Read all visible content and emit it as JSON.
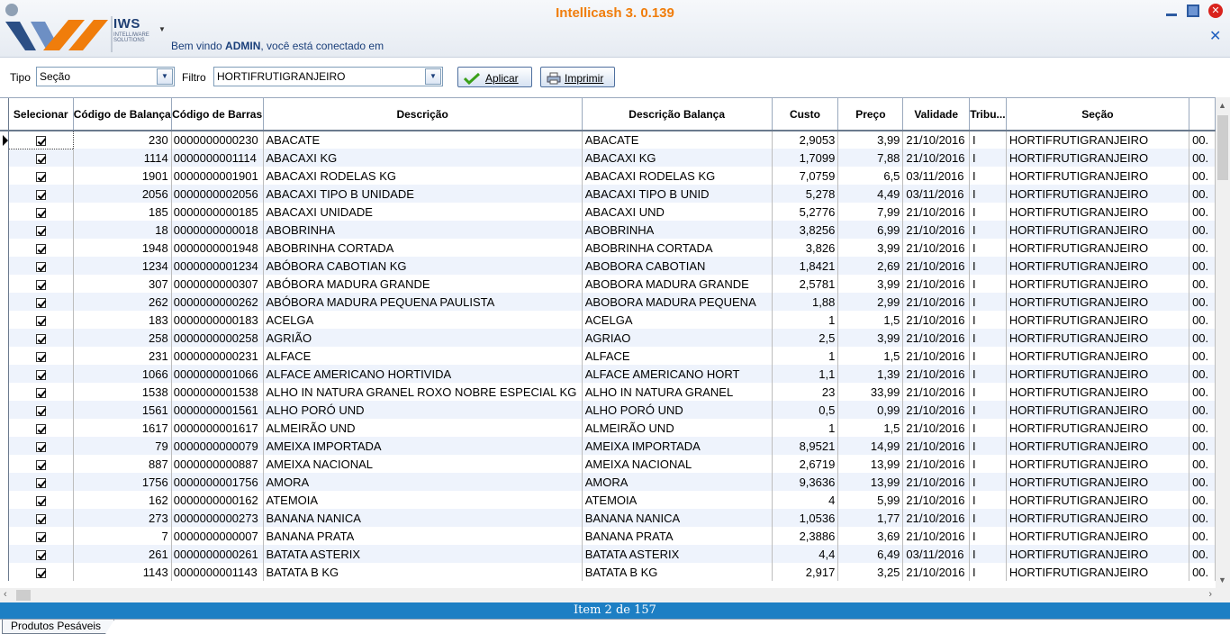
{
  "app": {
    "title": "Intellicash 3. 0.139",
    "logo_text": "IWS",
    "logo_sub": "INTELLIWARE SOLUTIONS",
    "welcome_prefix": "Bem vindo ",
    "welcome_user": "ADMIN",
    "welcome_suffix": ", você está conectado em"
  },
  "toolbar": {
    "tipo_label": "Tipo",
    "tipo_value": "Seção",
    "filtro_label": "Filtro",
    "filtro_value": "HORTIFRUTIGRANJEIRO",
    "apply_label": "Aplicar",
    "print_label": "Imprimir"
  },
  "grid": {
    "columns": [
      "Selecionar",
      "Código de Balança",
      "Código de Barras",
      "Descrição",
      "Descrição Balança",
      "Custo",
      "Preço",
      "Validade",
      "Tribu...",
      "Seção"
    ],
    "rows": [
      [
        "230",
        "0000000000230",
        "ABACATE",
        "ABACATE",
        "2,9053",
        "3,99",
        "21/10/2016",
        "I",
        "HORTIFRUTIGRANJEIRO",
        "00."
      ],
      [
        "1114",
        "0000000001114",
        "ABACAXI KG",
        "ABACAXI KG",
        "1,7099",
        "7,88",
        "21/10/2016",
        "I",
        "HORTIFRUTIGRANJEIRO",
        "00."
      ],
      [
        "1901",
        "0000000001901",
        "ABACAXI RODELAS KG",
        "ABACAXI RODELAS KG",
        "7,0759",
        "6,5",
        "03/11/2016",
        "I",
        "HORTIFRUTIGRANJEIRO",
        "00."
      ],
      [
        "2056",
        "0000000002056",
        "ABACAXI TIPO B UNIDADE",
        "ABACAXI TIPO B UNID",
        "5,278",
        "4,49",
        "03/11/2016",
        "I",
        "HORTIFRUTIGRANJEIRO",
        "00."
      ],
      [
        "185",
        "0000000000185",
        "ABACAXI UNIDADE",
        "ABACAXI UND",
        "5,2776",
        "7,99",
        "21/10/2016",
        "I",
        "HORTIFRUTIGRANJEIRO",
        "00."
      ],
      [
        "18",
        "0000000000018",
        "ABOBRINHA",
        "ABOBRINHA",
        "3,8256",
        "6,99",
        "21/10/2016",
        "I",
        "HORTIFRUTIGRANJEIRO",
        "00."
      ],
      [
        "1948",
        "0000000001948",
        "ABOBRINHA CORTADA",
        "ABOBRINHA CORTADA",
        "3,826",
        "3,99",
        "21/10/2016",
        "I",
        "HORTIFRUTIGRANJEIRO",
        "00."
      ],
      [
        "1234",
        "0000000001234",
        "ABÓBORA CABOTIAN KG",
        "ABOBORA CABOTIAN",
        "1,8421",
        "2,69",
        "21/10/2016",
        "I",
        "HORTIFRUTIGRANJEIRO",
        "00."
      ],
      [
        "307",
        "0000000000307",
        "ABÓBORA MADURA GRANDE",
        "ABOBORA MADURA GRANDE",
        "2,5781",
        "3,99",
        "21/10/2016",
        "I",
        "HORTIFRUTIGRANJEIRO",
        "00."
      ],
      [
        "262",
        "0000000000262",
        "ABÓBORA MADURA PEQUENA PAULISTA",
        "ABOBORA MADURA PEQUENA",
        "1,88",
        "2,99",
        "21/10/2016",
        "I",
        "HORTIFRUTIGRANJEIRO",
        "00."
      ],
      [
        "183",
        "0000000000183",
        "ACELGA",
        "ACELGA",
        "1",
        "1,5",
        "21/10/2016",
        "I",
        "HORTIFRUTIGRANJEIRO",
        "00."
      ],
      [
        "258",
        "0000000000258",
        "AGRIÃO",
        "AGRIAO",
        "2,5",
        "3,99",
        "21/10/2016",
        "I",
        "HORTIFRUTIGRANJEIRO",
        "00."
      ],
      [
        "231",
        "0000000000231",
        "ALFACE",
        "ALFACE",
        "1",
        "1,5",
        "21/10/2016",
        "I",
        "HORTIFRUTIGRANJEIRO",
        "00."
      ],
      [
        "1066",
        "0000000001066",
        "ALFACE AMERICANO HORTIVIDA",
        "ALFACE AMERICANO HORT",
        "1,1",
        "1,39",
        "21/10/2016",
        "I",
        "HORTIFRUTIGRANJEIRO",
        "00."
      ],
      [
        "1538",
        "0000000001538",
        "ALHO IN NATURA GRANEL ROXO NOBRE ESPECIAL KG",
        "ALHO IN NATURA GRANEL",
        "23",
        "33,99",
        "21/10/2016",
        "I",
        "HORTIFRUTIGRANJEIRO",
        "00."
      ],
      [
        "1561",
        "0000000001561",
        "ALHO PORÓ UND",
        "ALHO PORÓ UND",
        "0,5",
        "0,99",
        "21/10/2016",
        "I",
        "HORTIFRUTIGRANJEIRO",
        "00."
      ],
      [
        "1617",
        "0000000001617",
        "ALMEIRÃO UND",
        "ALMEIRÃO UND",
        "1",
        "1,5",
        "21/10/2016",
        "I",
        "HORTIFRUTIGRANJEIRO",
        "00."
      ],
      [
        "79",
        "0000000000079",
        "AMEIXA IMPORTADA",
        "AMEIXA IMPORTADA",
        "8,9521",
        "14,99",
        "21/10/2016",
        "I",
        "HORTIFRUTIGRANJEIRO",
        "00."
      ],
      [
        "887",
        "0000000000887",
        "AMEIXA NACIONAL",
        "AMEIXA NACIONAL",
        "2,6719",
        "13,99",
        "21/10/2016",
        "I",
        "HORTIFRUTIGRANJEIRO",
        "00."
      ],
      [
        "1756",
        "0000000001756",
        "AMORA",
        "AMORA",
        "9,3636",
        "13,99",
        "21/10/2016",
        "I",
        "HORTIFRUTIGRANJEIRO",
        "00."
      ],
      [
        "162",
        "0000000000162",
        "ATEMOIA",
        "ATEMOIA",
        "4",
        "5,99",
        "21/10/2016",
        "I",
        "HORTIFRUTIGRANJEIRO",
        "00."
      ],
      [
        "273",
        "0000000000273",
        "BANANA NANICA",
        "BANANA NANICA",
        "1,0536",
        "1,77",
        "21/10/2016",
        "I",
        "HORTIFRUTIGRANJEIRO",
        "00."
      ],
      [
        "7",
        "0000000000007",
        "BANANA PRATA",
        "BANANA PRATA",
        "2,3886",
        "3,69",
        "21/10/2016",
        "I",
        "HORTIFRUTIGRANJEIRO",
        "00."
      ],
      [
        "261",
        "0000000000261",
        "BATATA ASTERIX",
        "BATATA ASTERIX",
        "4,4",
        "6,49",
        "03/11/2016",
        "I",
        "HORTIFRUTIGRANJEIRO",
        "00."
      ],
      [
        "1143",
        "0000000001143",
        "BATATA B KG",
        "BATATA B KG",
        "2,917",
        "3,25",
        "21/10/2016",
        "I",
        "HORTIFRUTIGRANJEIRO",
        "00."
      ]
    ]
  },
  "status": {
    "text": "Item 2 de 157"
  },
  "tabs": {
    "active": "Produtos Pesáveis"
  }
}
